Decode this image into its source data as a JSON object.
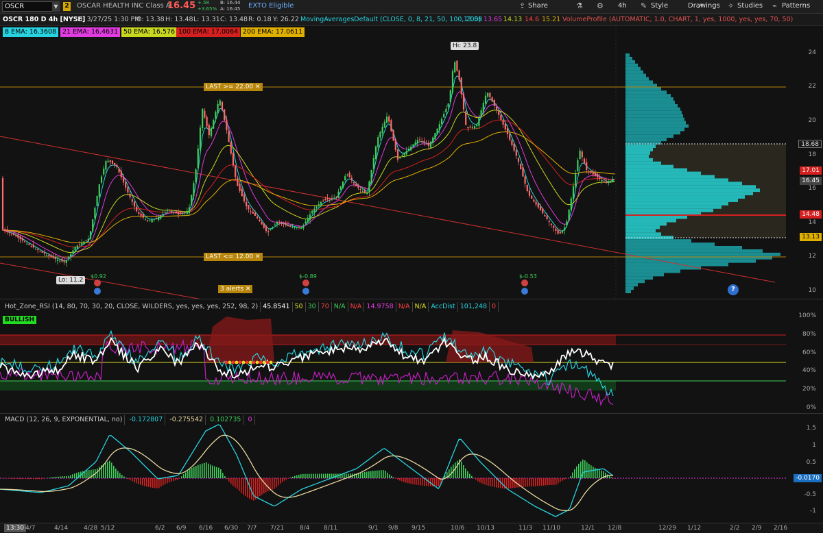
{
  "toolbar": {
    "symbol": "OSCR",
    "link_badge": "2",
    "company": "OSCAR HEALTH INC Class A",
    "price": "16.45",
    "change": "+.58",
    "change_pct": "+3.65%",
    "bid": "B: 16.44",
    "ask": "A: 16.45",
    "exto": "EXTO Eligible",
    "share": "Share",
    "timeframe": "4h",
    "style": "Style",
    "drawings": "Drawings",
    "studies": "Studies",
    "patterns": "Patterns"
  },
  "infoline": {
    "title": "OSCR 180 D 4h [NYSE]",
    "date": "D: 3/27/25 1:30 PM",
    "open": "O: 13.38",
    "high": "H: 13.48",
    "low": "L: 13.31",
    "close": "C: 13.48",
    "range": "R: 0.18",
    "y": "Y: 26.22",
    "ma_study": "MovingAveragesDefault (CLOSE, 0, 8, 21, 50, 100, 200)",
    "ma_v1": "13.58",
    "ma_v2": "13.65",
    "ma_v3": "14.13",
    "ma_v4": "14.6",
    "ma_v5": "15.21",
    "vp_study": "VolumeProfile (AUTOMATIC, 1.0, CHART, 1, yes, 1000, yes, yes, 70, 50)"
  },
  "ema_legend": [
    {
      "label": "8 EMA: 16.3608",
      "color": "#27d3e0"
    },
    {
      "label": "21 EMA: 16.4631",
      "color": "#e03ce0"
    },
    {
      "label": "50 EMA: 16.576",
      "color": "#c8d81e"
    },
    {
      "label": "100 EMA: 17.0064",
      "color": "#d42020"
    },
    {
      "label": "200 EMA: 17.0611",
      "color": "#e0b000"
    }
  ],
  "price_axis": {
    "ticks": [
      "24",
      "22",
      "20",
      "18",
      "16",
      "14",
      "12",
      "10"
    ],
    "tags": [
      {
        "label": "18.68",
        "bg": "#1a1a1a",
        "fg": "#ddd"
      },
      {
        "label": "17.01",
        "bg": "#d42020",
        "fg": "#fff"
      },
      {
        "label": "16.45",
        "bg": "#444",
        "fg": "#fff"
      },
      {
        "label": "14.48",
        "bg": "#d42020",
        "fg": "#fff"
      },
      {
        "label": "13.13",
        "bg": "#e0b000",
        "fg": "#000"
      }
    ]
  },
  "annotations": {
    "hi": "Hi: 23.8",
    "lo": "Lo: 11.2",
    "alert_high": "LAST >= 22.00 ✕",
    "alert_low": "LAST <= 12.00 ✕",
    "alerts": "3 alerts ✕",
    "div1": "$0.92",
    "div2": "$-0.89",
    "div3": "$-0.53",
    "help": "?"
  },
  "rsi": {
    "study": "Hot_Zone_RSI (14, 80, 70, 30, 20, CLOSE, WILDERS, yes, yes, yes, 252, 98, 2)",
    "values": [
      "45.8541",
      "50",
      "30",
      "70",
      "N/A",
      "N/A",
      "14.9758",
      "N/A",
      "N/A",
      "AccDist",
      "101,248",
      "0"
    ],
    "colors": [
      "#ffffff",
      "#e0e020",
      "#3ecf5a",
      "#ff4040",
      "#3ecf5a",
      "#ff4040",
      "#e03ce0",
      "#ff4040",
      "#e0e020",
      "#27d3e0",
      "#27d3e0",
      "#ff4040"
    ],
    "bullish": "BULLISH",
    "ticks": [
      "100%",
      "80%",
      "60%",
      "40%",
      "20%",
      "0%"
    ]
  },
  "macd": {
    "study": "MACD (12, 26, 9, EXPONENTIAL, no)",
    "v1": "-0.172807",
    "v2": "-0.275542",
    "v3": "0.102735",
    "v4": "0",
    "ticks": [
      "1.5",
      "1",
      "0.5",
      "0",
      "-0.5",
      "-1"
    ],
    "tag": "-0.0170"
  },
  "xaxis": {
    "time": "13:30",
    "labels": [
      "4/7",
      "4/14",
      "4/28",
      "5/12",
      "6/2",
      "6/9",
      "6/16",
      "6/30",
      "7/7",
      "7/21",
      "8/4",
      "8/11",
      "9/1",
      "9/8",
      "9/15",
      "10/6",
      "10/13",
      "11/3",
      "11/10",
      "12/1",
      "12/8",
      "12/29",
      "1/12",
      "2/2",
      "2/9",
      "2/16"
    ]
  }
}
